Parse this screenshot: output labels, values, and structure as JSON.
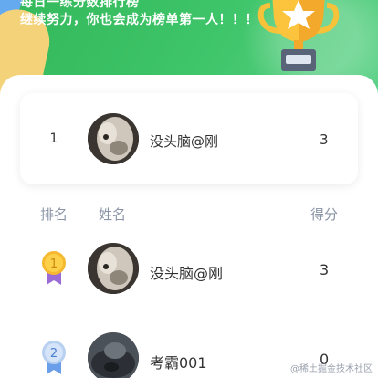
{
  "hero": {
    "line1": "每日一练分数排行榜",
    "line2": "继续努力，你也会成为榜单第一人！！！"
  },
  "my_rank": {
    "rank": "1",
    "name": "没头脑@刚",
    "score": "3"
  },
  "table_header": {
    "rank": "排名",
    "name": "姓名",
    "score": "得分"
  },
  "rows": [
    {
      "rank": "1",
      "name": "没头脑@刚",
      "score": "3",
      "medal_color": "#f5b82e"
    },
    {
      "rank": "2",
      "name": "考霸001",
      "score": "0",
      "medal_color": "#8bb6ea"
    }
  ],
  "colors": {
    "hero_green": "#3fc56a",
    "header_text": "#8a94a6",
    "medal_gold": "#f5b82e",
    "medal_ribbon_gold": "#9b6bd6",
    "medal_silver": "#8bb6ea",
    "medal_ribbon_silver": "#6a9ee8"
  },
  "watermark": "@稀土掘金技术社区"
}
